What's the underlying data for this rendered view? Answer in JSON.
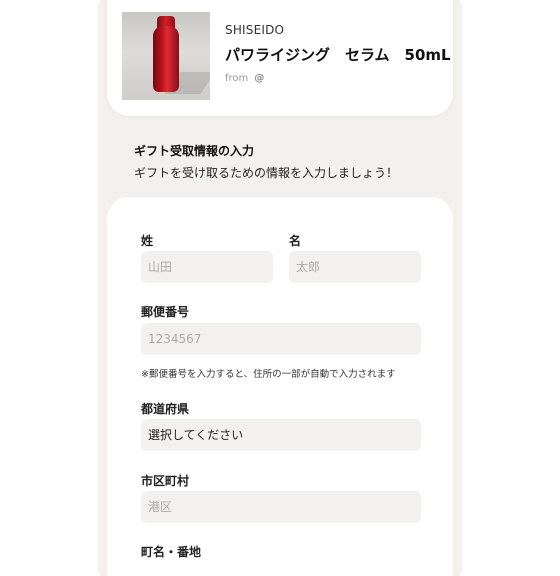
{
  "product": {
    "brand": "SHISEIDO",
    "name": "パワライジング　セラム　50mL",
    "from_label": "from",
    "from_value": "@"
  },
  "section": {
    "title": "ギフト受取情報の入力",
    "subtitle": "ギフトを受け取るための情報を入力しましょう！"
  },
  "form": {
    "last_name": {
      "label": "姓",
      "placeholder": "山田"
    },
    "first_name": {
      "label": "名",
      "placeholder": "太郎"
    },
    "postal_code": {
      "label": "郵便番号",
      "placeholder": "1234567",
      "note": "※郵便番号を入力すると、住所の一部が自動で入力されます"
    },
    "prefecture": {
      "label": "都道府県",
      "value": "選択してください"
    },
    "city": {
      "label": "市区町村",
      "placeholder": "港区"
    },
    "town": {
      "label": "町名・番地"
    }
  }
}
